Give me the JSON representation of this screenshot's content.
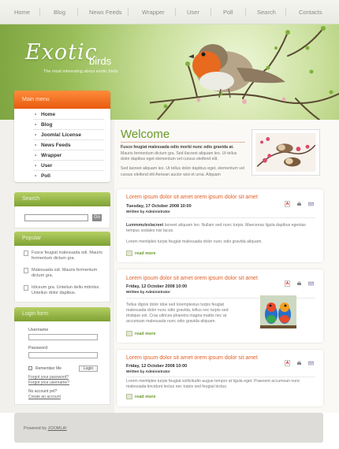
{
  "nav": [
    "Home",
    "Blog",
    "News Feeds",
    "Wrapper",
    "User",
    "Poll",
    "Search",
    "Contacts"
  ],
  "logo": {
    "title": "Exotic",
    "subtitle": "birds",
    "tagline": "The most interesting about exotic birds"
  },
  "mainmenu": {
    "title": "Main menu",
    "items": [
      "Home",
      "Blog",
      "Joomla! License",
      "News Feeds",
      "Wrapper",
      "User",
      "Poll"
    ]
  },
  "search": {
    "title": "Search",
    "go_label": "Go"
  },
  "popular": {
    "title": "Popular",
    "items": [
      "Fusce feugiat malesuada odi. Mauris fermentum dictum gra.",
      "Malesuada odi. Mauris fermentum dictum gra.",
      "Idiceum gra. Unteliun dellu mtimlss. Unteliun dolor dapibus."
    ]
  },
  "login": {
    "title": "Login form",
    "username_label": "Username",
    "password_label": "Password",
    "remember_label": "Remember Me",
    "login_button": "Login",
    "forgot_password": "Forgot your password?",
    "forgot_username": "Forgot your username?",
    "no_account": "No account yet?",
    "create_account": "Create an account"
  },
  "welcome": {
    "title": "Welcome",
    "lead_bold": "Fusce feugiat malesuada odio morbi nunc odio gravida at.",
    "lead_rest": "Mauris fermentum dictum gra. Sed ilacreet aliquam leo. Ut tellus dolor dapibus eget elementum vel cursus eleifend elit.",
    "para2": "Sed laoreet aliquam leo. Ut tellus dolor dapibus eget, elementum vel cursus eleifend elit Aenean auctor wisi et urna. Aliquam"
  },
  "articles": [
    {
      "title": "Lorem ipsum dolor sit amet orem ipsum dolor sit amet",
      "date": "Tuesday, 17 October 2008 10:00",
      "author": "Written by Administrator",
      "bold": "Lummmulexlacreet",
      "text1": "laoreet aliquam leo. Nullam sed nunc turpis. Maecenas ligula dapibus egestas tempus sodales nisi lacus.",
      "text2": "Lorem mentiplex turpis feugiat malesuada dolor nunc odio gravida aliquam.",
      "readmore": "read more"
    },
    {
      "title": "Lorem ipsum dolor sit amet orem ipsum dolor sit amet",
      "date": "Friday, 12 October 2008 10:00",
      "author": "Written by Administrator",
      "text1": "Tellus dignis dolor idoe sed loremplexius turpis feugiat malesuada dolor nunc odio gravida, tellus nec turpis sed tristique est. Cras ultrices pharetra magna mattis nec at accumsan malesuada nunc odio gravida aliquam.",
      "readmore": "read more"
    },
    {
      "title": "Lorem ipsum dolor sit amet orem ipsum dolor sit amet",
      "date": "Friday, 12 October 2008 10:00",
      "author": "Written by Administrator",
      "text1": "Lorem mentiplex turpis feugiat sollicitudin augue tempor at ligula eget. Praesent accumsan nunc malesuada tincidunt lectus nec turpis sed feugiat lectus.",
      "readmore": "read more"
    }
  ],
  "footer": {
    "powered_by": "Powered by",
    "link": "JOOMLA!"
  }
}
